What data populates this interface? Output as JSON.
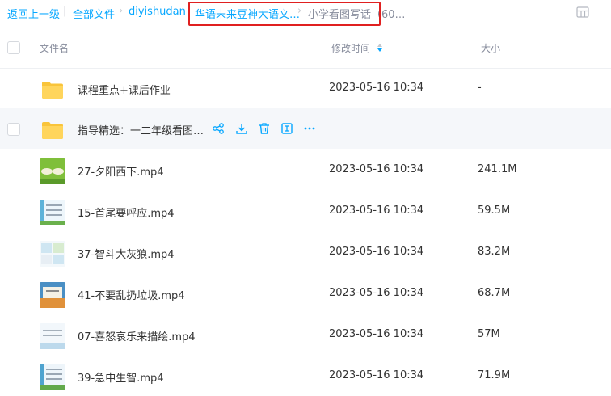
{
  "breadcrumb": {
    "back": "返回上一级",
    "all_files": "全部文件",
    "diyishudan": "diyishudan",
    "folder_highlighted": "华语未来豆神大语文…",
    "current": "小学看图写话（60…"
  },
  "header": {
    "filename": "文件名",
    "modified": "修改时间",
    "size": "大小"
  },
  "files": [
    {
      "name": "课程重点+课后作业",
      "time": "2023-05-16 10:34",
      "size": "-",
      "thumb": "folder-icon"
    },
    {
      "name": "指导精选：一二年级看图…",
      "time": "",
      "size": "",
      "thumb": "folder-icon"
    },
    {
      "name": "27-夕阳西下.mp4",
      "time": "2023-05-16 10:34",
      "size": "241.1M",
      "thumb": "video-thumbnail"
    },
    {
      "name": "15-首尾要呼应.mp4",
      "time": "2023-05-16 10:34",
      "size": "59.5M",
      "thumb": "video-thumbnail"
    },
    {
      "name": "37-智斗大灰狼.mp4",
      "time": "2023-05-16 10:34",
      "size": "83.2M",
      "thumb": "video-thumbnail"
    },
    {
      "name": "41-不要乱扔垃圾.mp4",
      "time": "2023-05-16 10:34",
      "size": "68.7M",
      "thumb": "video-thumbnail"
    },
    {
      "name": "07-喜怒哀乐来描绘.mp4",
      "time": "2023-05-16 10:34",
      "size": "57M",
      "thumb": "video-thumbnail"
    },
    {
      "name": "39-急中生智.mp4",
      "time": "2023-05-16 10:34",
      "size": "71.9M",
      "thumb": "video-thumbnail"
    }
  ],
  "colors": {
    "link": "#06a7ff",
    "highlight_border": "#e02020",
    "folder": "#f9c43a"
  }
}
